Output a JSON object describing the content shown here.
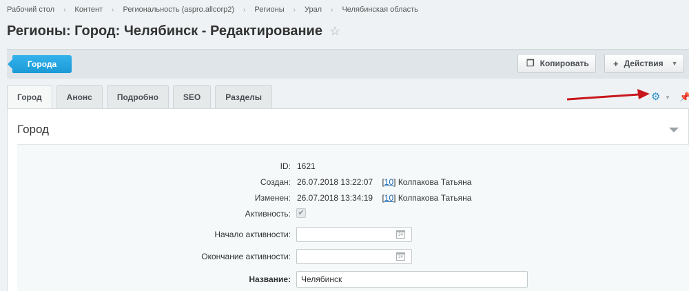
{
  "breadcrumb": [
    "Рабочий стол",
    "Контент",
    "Региональность (aspro.allcorp2)",
    "Регионы",
    "Урал",
    "Челябинская область"
  ],
  "page": {
    "title": "Регионы: Город: Челябинск - Редактирование"
  },
  "toolbar": {
    "back_label": "Города",
    "copy_label": "Копировать",
    "actions_label": "Действия"
  },
  "tabs": [
    {
      "label": "Город",
      "active": true
    },
    {
      "label": "Анонс",
      "active": false
    },
    {
      "label": "Подробно",
      "active": false
    },
    {
      "label": "SEO",
      "active": false
    },
    {
      "label": "Разделы",
      "active": false
    }
  ],
  "section": {
    "title": "Город"
  },
  "fields": {
    "id": {
      "label": "ID:",
      "value": "1621"
    },
    "created": {
      "label": "Создан:",
      "date": "26.07.2018 13:22:07",
      "user_id": "10",
      "user_name": "Колпакова Татьяна"
    },
    "modified": {
      "label": "Изменен:",
      "date": "26.07.2018 13:34:19",
      "user_id": "10",
      "user_name": "Колпакова Татьяна"
    },
    "active": {
      "label": "Активность:",
      "checked": true
    },
    "active_from": {
      "label": "Начало активности:",
      "value": ""
    },
    "active_to": {
      "label": "Окончание активности:",
      "value": ""
    },
    "name": {
      "label": "Название:",
      "value": "Челябинск"
    }
  },
  "icons": {
    "calendar_day": "24"
  },
  "colors": {
    "accent": "#1b9ad6",
    "annotation_arrow": "#c8161d",
    "link": "#2067b0"
  }
}
